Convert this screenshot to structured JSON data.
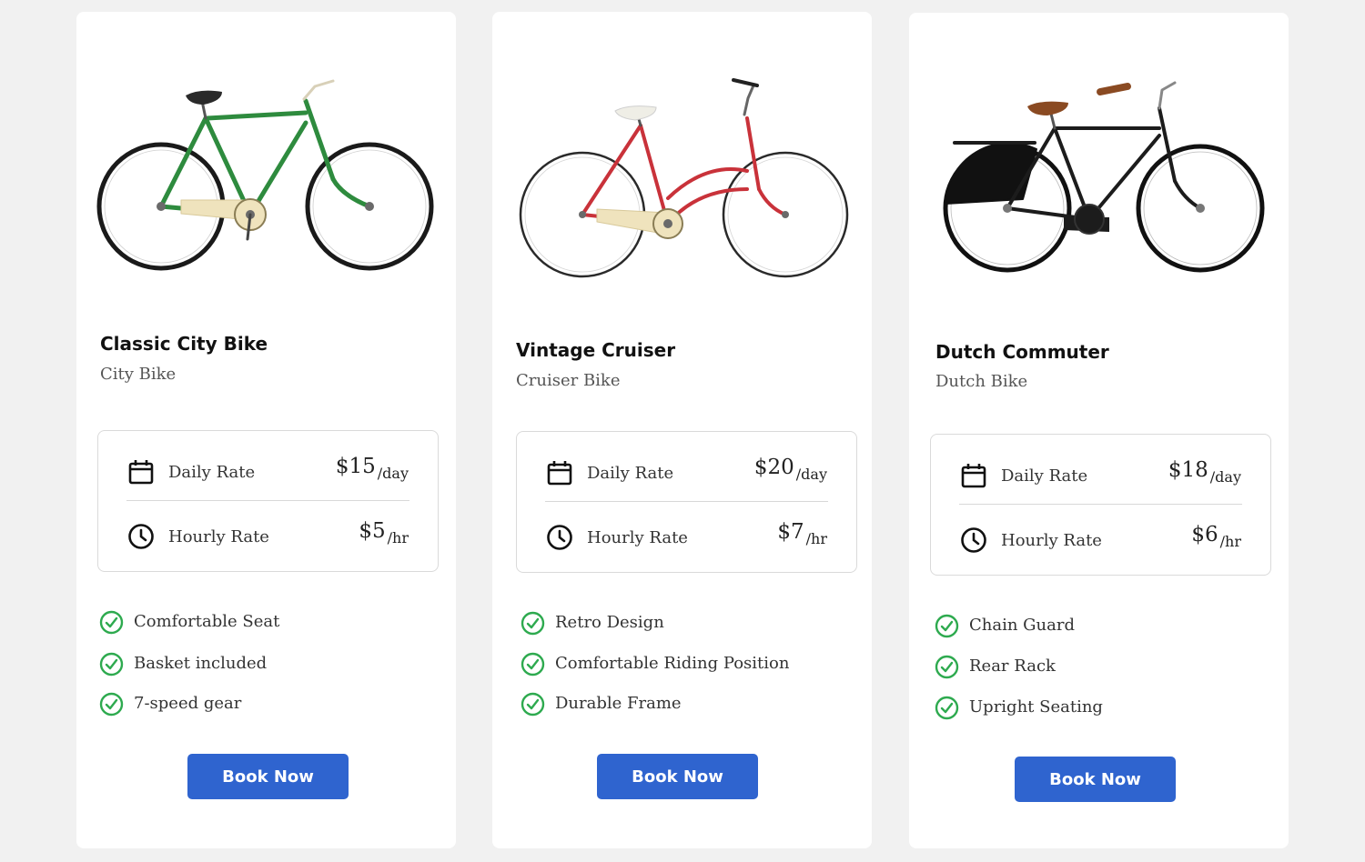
{
  "cards": [
    {
      "title": "Classic City Bike",
      "subtitle": "City Bike",
      "frame_color": "#2e8b3e",
      "daily_label": "Daily Rate",
      "daily_price": "$15",
      "daily_unit": "/day",
      "hourly_label": "Hourly Rate",
      "hourly_price": "$5",
      "hourly_unit": "/hr",
      "features": [
        "Comfortable Seat",
        "Basket included",
        "7-speed gear"
      ],
      "button": "Book Now"
    },
    {
      "title": "Vintage Cruiser",
      "subtitle": "Cruiser Bike",
      "frame_color": "#c9323a",
      "daily_label": "Daily Rate",
      "daily_price": "$20",
      "daily_unit": "/day",
      "hourly_label": "Hourly Rate",
      "hourly_price": "$7",
      "hourly_unit": "/hr",
      "features": [
        "Retro Design",
        "Comfortable Riding Position",
        "Durable Frame"
      ],
      "button": "Book Now"
    },
    {
      "title": "Dutch Commuter",
      "subtitle": "Dutch Bike",
      "frame_color": "#1c1c1c",
      "daily_label": "Daily Rate",
      "daily_price": "$18",
      "daily_unit": "/day",
      "hourly_label": "Hourly Rate",
      "hourly_price": "$6",
      "hourly_unit": "/hr",
      "features": [
        "Chain Guard",
        "Rear Rack",
        "Upright Seating"
      ],
      "button": "Book Now"
    }
  ],
  "colors": {
    "accent": "#2f64cf",
    "check": "#2eaa4f",
    "background": "#f1f1f1"
  },
  "icons": {
    "daily": "calendar-icon",
    "hourly": "clock-icon",
    "feature": "check-circle-icon"
  }
}
